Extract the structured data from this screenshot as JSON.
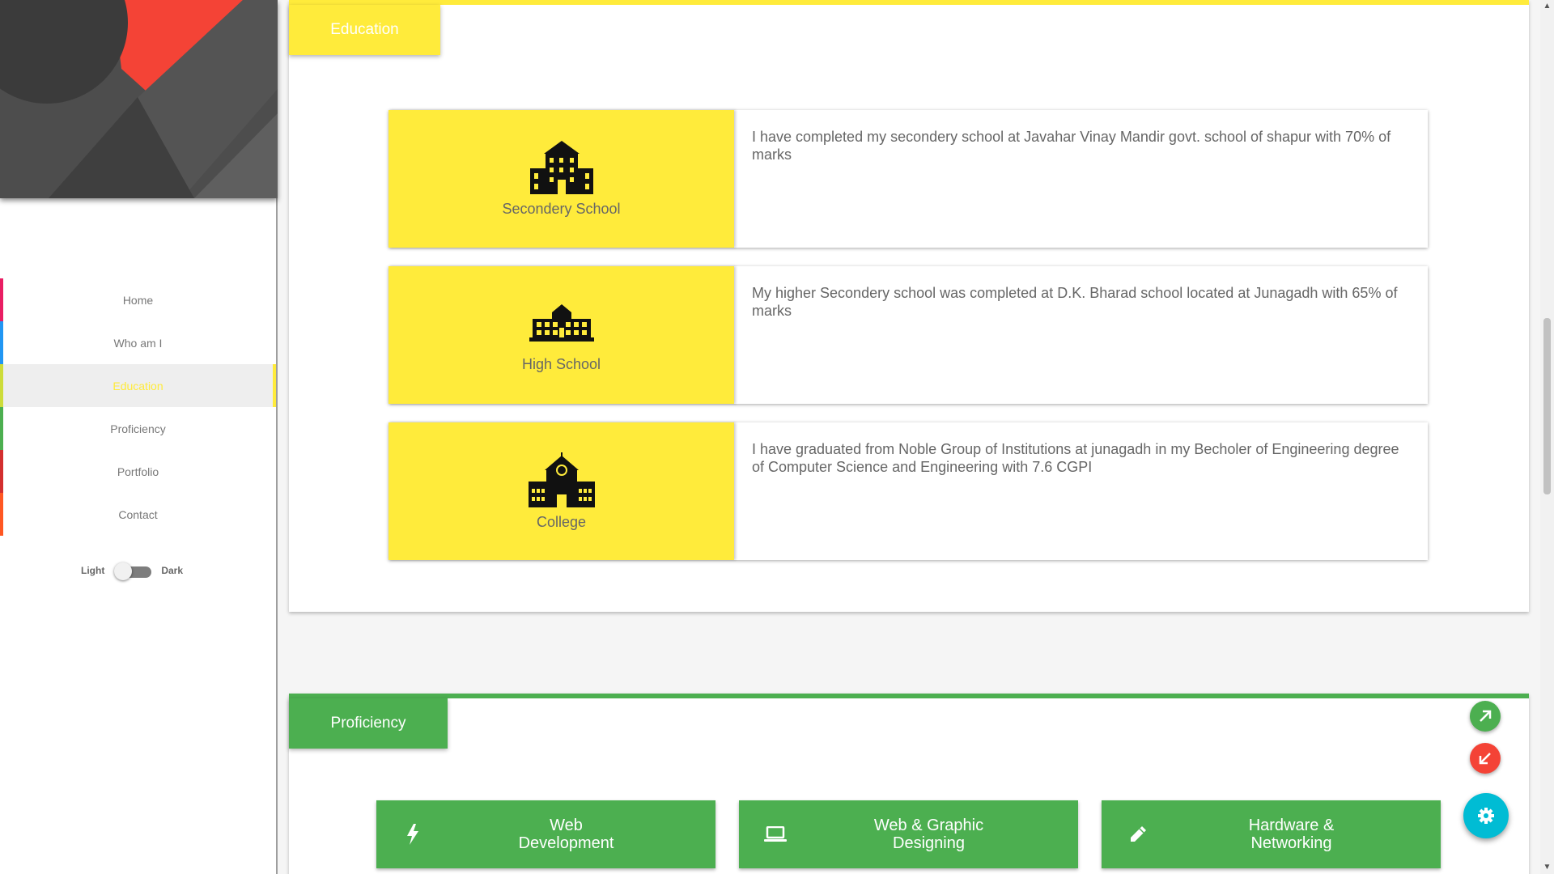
{
  "sidebar": {
    "nav": [
      {
        "label": "Home",
        "color": "#e91e63"
      },
      {
        "label": "Who am I",
        "color": "#2196f3"
      },
      {
        "label": "Education",
        "color": "#cddc39"
      },
      {
        "label": "Proficiency",
        "color": "#4caf50"
      },
      {
        "label": "Portfolio",
        "color": "#d32f2f"
      },
      {
        "label": "Contact",
        "color": "#ff5722"
      }
    ],
    "active_item": "Education",
    "theme": {
      "light_label": "Light",
      "dark_label": "Dark",
      "value": "Light"
    }
  },
  "education": {
    "title": "Education",
    "accent": "#ffeb3b",
    "items": [
      {
        "label": "Secondery School",
        "icon": "school-building-icon",
        "text": "I have completed my secondery school at Javahar Vinay Mandir govt. school of shapur with 70% of marks"
      },
      {
        "label": "High School",
        "icon": "high-school-building-icon",
        "text": "My higher Secondery school was completed at D.K. Bharad school located at Junagadh with 65% of marks"
      },
      {
        "label": "College",
        "icon": "college-building-icon",
        "text": "I have graduated from Noble Group of Institutions at junagadh in my Becholer of Engineering degree of Computer Science and Engineering with 7.6 CGPI"
      }
    ]
  },
  "proficiency": {
    "title": "Proficiency",
    "accent": "#4caf50",
    "items": [
      {
        "line1": "Web",
        "line2": "Development",
        "icon": "lightning-icon"
      },
      {
        "line1": "Web & Graphic",
        "line2": "Designing",
        "icon": "laptop-icon"
      },
      {
        "line1": "Hardware &",
        "line2": "Networking",
        "icon": "pencil-icon"
      }
    ]
  },
  "fabs": {
    "up": {
      "icon": "arrow-up-right-icon",
      "color": "#4caf50"
    },
    "down": {
      "icon": "arrow-down-left-icon",
      "color": "#f44336"
    },
    "settings": {
      "icon": "gear-icon",
      "color": "#00bcd4"
    }
  }
}
